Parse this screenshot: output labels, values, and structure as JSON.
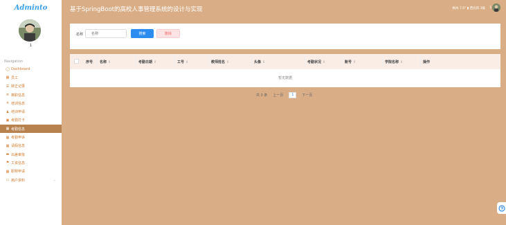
{
  "brand": "Adminto",
  "user": {
    "name": "1"
  },
  "nav_heading": "Navigation",
  "nav_items": [
    {
      "icon": "◯",
      "label": "Dashboard",
      "active": false
    },
    {
      "icon": "▦",
      "label": "员工",
      "active": false
    },
    {
      "icon": "☰",
      "label": "转正记录",
      "active": false
    },
    {
      "icon": "≡",
      "label": "离职信息",
      "active": false
    },
    {
      "icon": "✈",
      "label": "培训信息",
      "active": false
    },
    {
      "icon": "♟",
      "label": "培训申请",
      "active": false
    },
    {
      "icon": "▣",
      "label": "考勤打卡",
      "active": false
    },
    {
      "icon": "▦",
      "label": "考勤信息",
      "active": true
    },
    {
      "icon": "▦",
      "label": "考勤申诉",
      "active": false
    },
    {
      "icon": "▦",
      "label": "请假信息",
      "active": false
    },
    {
      "icon": "▬",
      "label": "出差审批",
      "active": false
    },
    {
      "icon": "⚑",
      "label": "工资信息",
      "active": false
    },
    {
      "icon": "▦",
      "label": "职称申请",
      "active": false
    },
    {
      "icon": "▭",
      "label": "用户资料",
      "active": false,
      "has_chevron": true
    }
  ],
  "header": {
    "title": "基于SpringBoot的高校人事管理系统的设计与实现",
    "weather": "梅州  7.6°  ▮  西北风  3级",
    "user_num": "1"
  },
  "search": {
    "label": "名称",
    "placeholder": "名称",
    "search_label": "搜索",
    "delete_label": "删除"
  },
  "table": {
    "columns": [
      "序号",
      "名称",
      "考勤日期",
      "工号",
      "教师姓名",
      "头像",
      "考勤状况",
      "账号",
      "学院名称",
      "操作"
    ],
    "sortable": [
      false,
      true,
      true,
      true,
      true,
      true,
      true,
      true,
      true,
      false
    ],
    "empty_text": "暂无数据"
  },
  "pager": {
    "total": "共 0 条",
    "prev": "上一页",
    "page": "1",
    "next": "下一页"
  }
}
